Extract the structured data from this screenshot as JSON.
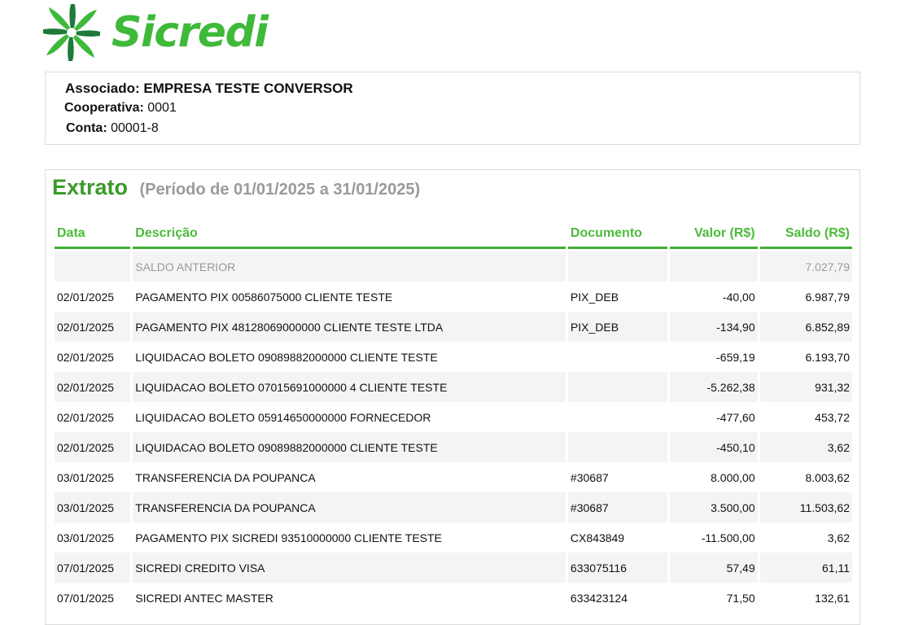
{
  "brand": {
    "name": "Sicredi",
    "color": "#3fb93a",
    "logo_icon": "sicredi-flower-logo"
  },
  "account": {
    "associado_label": "Associado:",
    "associado_value": "EMPRESA TESTE CONVERSOR",
    "cooperativa_label": "Cooperativa:",
    "cooperativa_value": "0001",
    "conta_label": "Conta:",
    "conta_value": "00001-8"
  },
  "statement": {
    "title": "Extrato",
    "period": "(Período de 01/01/2025 a 31/01/2025)",
    "columns": [
      "Data",
      "Descrição",
      "Documento",
      "Valor (R$)",
      "Saldo (R$)"
    ],
    "rows": [
      {
        "data": "",
        "descricao": "SALDO ANTERIOR",
        "documento": "",
        "valor": "",
        "saldo": "7.027,79"
      },
      {
        "data": "02/01/2025",
        "descricao": "PAGAMENTO PIX 00586075000 CLIENTE TESTE",
        "documento": "PIX_DEB",
        "valor": "-40,00",
        "saldo": "6.987,79"
      },
      {
        "data": "02/01/2025",
        "descricao": "PAGAMENTO PIX 48128069000000 CLIENTE TESTE LTDA",
        "documento": "PIX_DEB",
        "valor": "-134,90",
        "saldo": "6.852,89"
      },
      {
        "data": "02/01/2025",
        "descricao": "LIQUIDACAO BOLETO 09089882000000 CLIENTE TESTE",
        "documento": "",
        "valor": "-659,19",
        "saldo": "6.193,70"
      },
      {
        "data": "02/01/2025",
        "descricao": "LIQUIDACAO BOLETO 07015691000000 4 CLIENTE TESTE",
        "documento": "",
        "valor": "-5.262,38",
        "saldo": "931,32"
      },
      {
        "data": "02/01/2025",
        "descricao": "LIQUIDACAO BOLETO 05914650000000  FORNECEDOR",
        "documento": "",
        "valor": "-477,60",
        "saldo": "453,72"
      },
      {
        "data": "02/01/2025",
        "descricao": "LIQUIDACAO BOLETO 09089882000000 CLIENTE TESTE",
        "documento": "",
        "valor": "-450,10",
        "saldo": "3,62"
      },
      {
        "data": "03/01/2025",
        "descricao": "TRANSFERENCIA DA POUPANCA",
        "documento": "#30687",
        "valor": "8.000,00",
        "saldo": "8.003,62"
      },
      {
        "data": "03/01/2025",
        "descricao": "TRANSFERENCIA DA POUPANCA",
        "documento": "#30687",
        "valor": "3.500,00",
        "saldo": "11.503,62"
      },
      {
        "data": "03/01/2025",
        "descricao": "PAGAMENTO PIX SICREDI 93510000000 CLIENTE TESTE",
        "documento": "CX843849",
        "valor": "-11.500,00",
        "saldo": "3,62"
      },
      {
        "data": "07/01/2025",
        "descricao": "SICREDI CREDITO VISA",
        "documento": "633075116",
        "valor": "57,49",
        "saldo": "61,11"
      },
      {
        "data": "07/01/2025",
        "descricao": "SICREDI ANTEC MASTER",
        "documento": "633423124",
        "valor": "71,50",
        "saldo": "132,61"
      }
    ]
  }
}
